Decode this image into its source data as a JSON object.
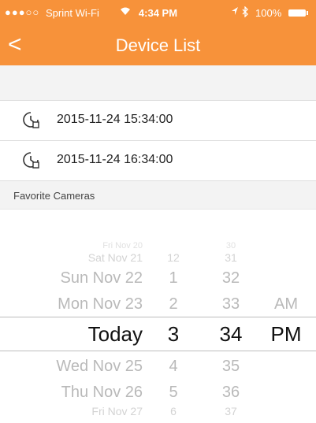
{
  "status_bar": {
    "signal": "●●●○○",
    "carrier": "Sprint Wi-Fi",
    "time": "4:34 PM",
    "battery": "100%"
  },
  "nav": {
    "back_label": "<",
    "title": "Device List"
  },
  "devices": [
    {
      "datetime": "2015-11-24 15:34:00",
      "icon": "history-clock-icon"
    },
    {
      "datetime": "2015-11-24 16:34:00",
      "icon": "history-clock-icon"
    }
  ],
  "section": {
    "title": "Favorite Cameras"
  },
  "picker": {
    "dates": [
      "Fri Nov 20",
      "Sat Nov 21",
      "Sun Nov 22",
      "Mon Nov 23",
      "Today",
      "Wed Nov 25",
      "Thu Nov 26",
      "Fri Nov 27"
    ],
    "hours": [
      "12",
      "1",
      "2",
      "3",
      "4",
      "5",
      "6"
    ],
    "minutes": [
      "30",
      "31",
      "32",
      "33",
      "34",
      "35",
      "36",
      "37"
    ],
    "ampm": [
      "AM",
      "PM"
    ],
    "selected": {
      "date": "Today",
      "hour": "3",
      "minute": "34",
      "ampm": "PM"
    }
  },
  "colors": {
    "accent": "#f7923a",
    "band": "#f3f3f3"
  }
}
